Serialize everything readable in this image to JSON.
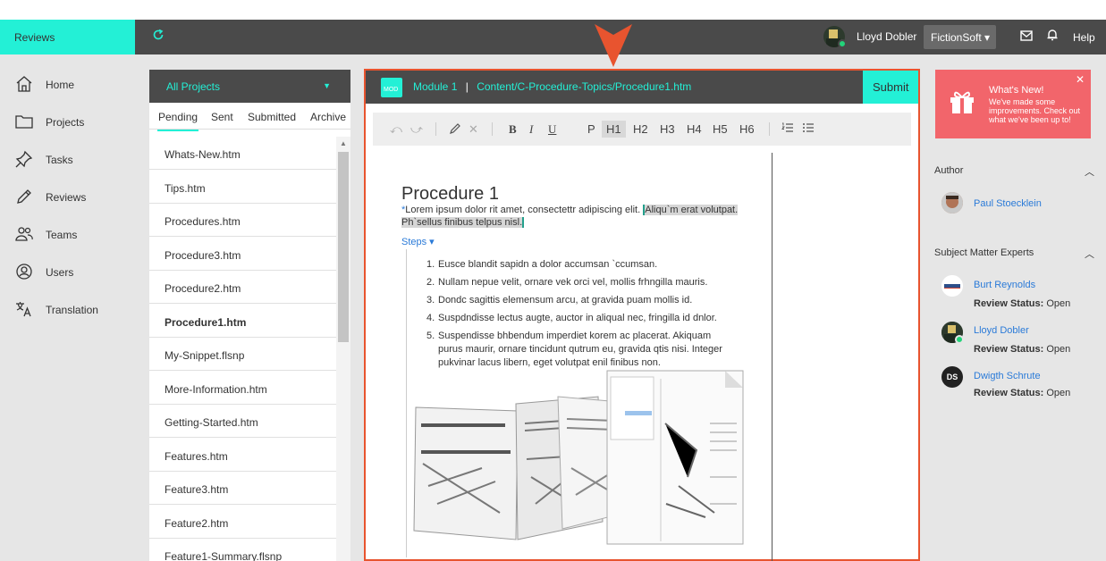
{
  "topbar": {
    "brand": "Reviews",
    "user_name": "Lloyd Dobler",
    "company": "FictionSoft ▾",
    "help": "Help"
  },
  "nav": {
    "items": [
      {
        "label": "Home",
        "icon": "home-icon"
      },
      {
        "label": "Projects",
        "icon": "folder-icon"
      },
      {
        "label": "Tasks",
        "icon": "pin-icon"
      },
      {
        "label": "Reviews",
        "icon": "pencil-icon"
      },
      {
        "label": "Teams",
        "icon": "team-icon"
      },
      {
        "label": "Users",
        "icon": "user-circle-icon"
      },
      {
        "label": "Translation",
        "icon": "translate-icon"
      }
    ]
  },
  "projects": {
    "selector": "All Projects",
    "tabs": [
      "Pending",
      "Sent",
      "Submitted",
      "Archive"
    ],
    "active_tab": "Pending",
    "files": [
      "Whats-New.htm",
      "Tips.htm",
      "Procedures.htm",
      "Procedure3.htm",
      "Procedure2.htm",
      "Procedure1.htm",
      "My-Snippet.flsnp",
      "More-Information.htm",
      "Getting-Started.htm",
      "Features.htm",
      "Feature3.htm",
      "Feature2.htm",
      "Feature1-Summary.flsnp"
    ],
    "selected_file": "Procedure1.htm"
  },
  "editor": {
    "module_icon_label": "MOD",
    "module": "Module 1",
    "separator": "|",
    "path": "Content/C-Procedure-Topics/Procedure1.htm",
    "submit": "Submit",
    "toolbar": {
      "bold": "B",
      "italic": "I",
      "underline": "U",
      "p": "P",
      "h1": "H1",
      "h2": "H2",
      "h3": "H3",
      "h4": "H4",
      "h5": "H5",
      "h6": "H6",
      "selected": "H1"
    },
    "doc": {
      "title": "Procedure 1",
      "marker": "*",
      "intro": "Lorem ipsum dolor rit amet, consectettr adipiscing elit. ",
      "highlight": "Aliqu`m erat volutpat. Ph`sellus finibus telpus nisl.",
      "steps_label": "Steps ▾",
      "steps": [
        "Eusce blandit sapidn a dolor accumsan `ccumsan.",
        "Nullam nepue velit, ornare vek orci vel, mollis frhngilla mauris.",
        "Dondc sagittis elemensum arcu, at gravida puam mollis id.",
        "Suspdndisse lectus augte, auctor in aliqual nec, fringilla id dnlor.",
        "Suspendisse bhbendum imperdiet korem ac placerat. Akiquam purus maurir, ornare tincidunt qutrum eu, gravida qtis nisi. Integer pukvinar lacus libern, eget volutpat enil finibus non."
      ]
    }
  },
  "whats_new": {
    "title": "What's New!",
    "message": "We've made some improvements. Check out what we've been up to!"
  },
  "author": {
    "title": "Author",
    "name": "Paul Stoecklein"
  },
  "sme": {
    "title": "Subject Matter Experts",
    "status_label": "Review Status:",
    "people": [
      {
        "name": "Burt Reynolds",
        "status": "Open"
      },
      {
        "name": "Lloyd Dobler",
        "status": "Open"
      },
      {
        "name": "Dwigth Schrute",
        "status": "Open",
        "initials": "DS"
      }
    ]
  },
  "colors": {
    "accent": "#23f0d6",
    "dark": "#4a4a4a",
    "alert": "#f2656b",
    "editor_border": "#e8542f",
    "link": "#2a7ad8"
  }
}
